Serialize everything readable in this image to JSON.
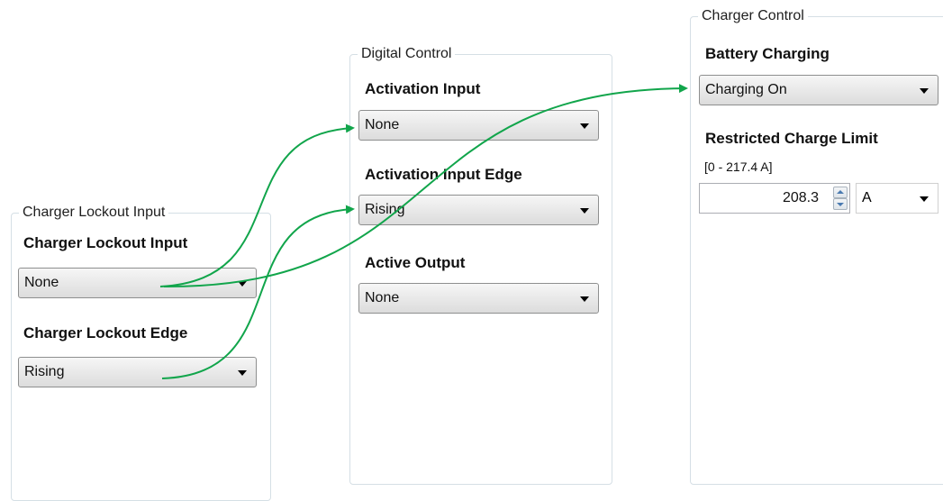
{
  "lockout_group": {
    "title": "Charger Lockout Input",
    "input_label": "Charger Lockout Input",
    "input_value": "None",
    "edge_label": "Charger Lockout Edge",
    "edge_value": "Rising"
  },
  "digital_group": {
    "title": "Digital Control",
    "activation_label": "Activation Input",
    "activation_value": "None",
    "edge_label": "Activation Input Edge",
    "edge_value": "Rising",
    "output_label": "Active Output",
    "output_value": "None"
  },
  "charger_group": {
    "title": "Charger Control",
    "battery_label": "Battery Charging",
    "battery_value": "Charging On",
    "limit_label": "Restricted Charge Limit",
    "limit_range": "[0 - 217.4 A]",
    "limit_value": "208.3",
    "limit_unit": "A"
  },
  "colors": {
    "arrow": "#11a54b",
    "group_border": "#d5dfe5"
  }
}
